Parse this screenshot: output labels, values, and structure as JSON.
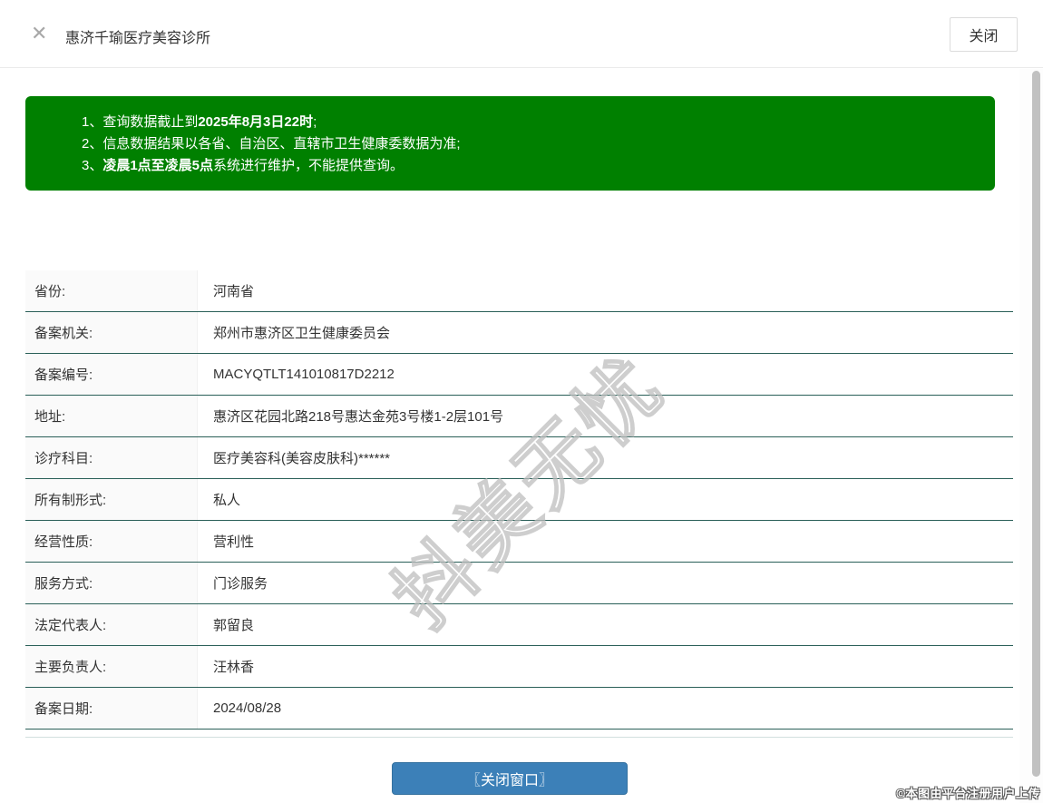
{
  "header": {
    "close_icon": "✕",
    "title": "惠济千瑜医疗美容诊所",
    "close_button_label": "关闭"
  },
  "notice": {
    "lines": [
      {
        "pre": "1、查询数据截止到",
        "bold": "2025年8月3日22时",
        "post": ";"
      },
      {
        "pre": "2、信息数据结果以各省、自治区、直辖市卫生健康委数据为准;",
        "bold": "",
        "post": ""
      },
      {
        "pre": "3、",
        "bold": "凌晨1点至凌晨5点",
        "post": "系统进行维护，不能提供查询。"
      }
    ]
  },
  "main": {
    "title": "惠济千瑜医疗美容诊所"
  },
  "table": {
    "rows": [
      {
        "label": "省份:",
        "value": "河南省"
      },
      {
        "label": "备案机关:",
        "value": "郑州市惠济区卫生健康委员会"
      },
      {
        "label": "备案编号:",
        "value": "MACYQTLT141010817D2212"
      },
      {
        "label": "地址:",
        "value": "惠济区花园北路218号惠达金苑3号楼1-2层101号"
      },
      {
        "label": "诊疗科目:",
        "value": "医疗美容科(美容皮肤科)******"
      },
      {
        "label": "所有制形式:",
        "value": "私人"
      },
      {
        "label": "经营性质:",
        "value": "营利性"
      },
      {
        "label": "服务方式:",
        "value": "门诊服务"
      },
      {
        "label": "法定代表人:",
        "value": "郭留良"
      },
      {
        "label": "主要负责人:",
        "value": "汪林香"
      },
      {
        "label": "备案日期:",
        "value": "2024/08/28"
      }
    ]
  },
  "footer": {
    "close_window_button": "〖关闭窗口〗",
    "copyright": "©本图由平台注册用户上传"
  },
  "watermark": "抖美无忧",
  "colors": {
    "notice_green": "#008000",
    "button_blue": "#3c80b8",
    "row_border_teal": "#2a5f58"
  }
}
